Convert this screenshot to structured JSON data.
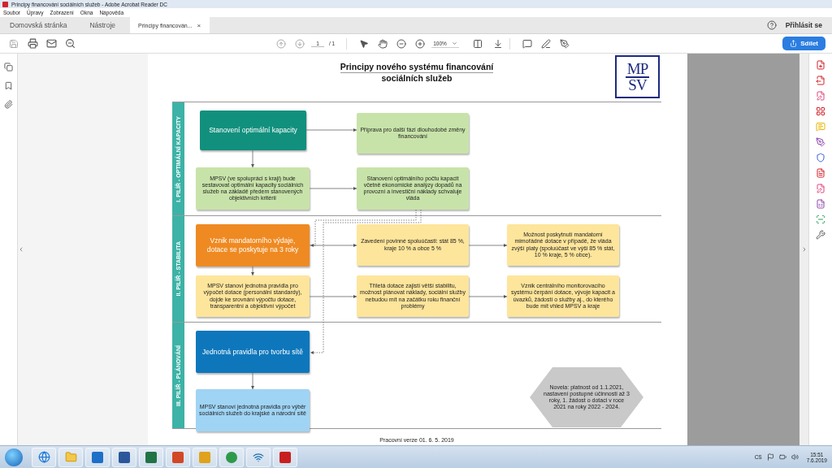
{
  "window": {
    "title": "Principy financování sociálních služeb - Adobe Acrobat Reader DC"
  },
  "menu": [
    "Soubor",
    "Úpravy",
    "Zobrazení",
    "Okna",
    "Nápověda"
  ],
  "tabs": [
    {
      "label": "Domovská stránka",
      "selected": false
    },
    {
      "label": "Nástroje",
      "selected": false
    },
    {
      "label": "Principy financován...",
      "selected": true,
      "close": "×"
    }
  ],
  "sign_in": "Přihlásit se",
  "toolbar": {
    "page_current": "1",
    "page_total": "/ 1",
    "zoom": "100%",
    "share": "Sdílet"
  },
  "document": {
    "title_lines": [
      "Principy nového systému financování",
      "sociálních služeb"
    ],
    "logo": [
      "MP",
      "SV"
    ],
    "lanes": [
      {
        "label": "I. PILÍŘ - OPTIMÁLNÍ KAPACITY",
        "nodes": [
          {
            "kind": "heading",
            "color": "#12907e",
            "text": "Stanovení optimální kapacity"
          },
          {
            "kind": "detail",
            "color": "#c8e3a9",
            "text": "Příprava pro další fázi dlouhodobé změny financování"
          },
          {
            "kind": "detail",
            "color": "#c8e3a9",
            "text": "MPSV (ve spolupráci s kraji) bude sestavovat optimální kapacity sociálních služeb na základě předem stanovených objektivních kritérií"
          },
          {
            "kind": "detail",
            "color": "#c8e3a9",
            "text": "Stanovení optimálního počtu kapacit včetně ekonomické analýzy dopadů na provozní a investiční náklady schvaluje vláda"
          }
        ]
      },
      {
        "label": "II. PILÍŘ - STABILITA",
        "nodes": [
          {
            "kind": "heading",
            "color": "#ef8a22",
            "text": "Vznik mandatorního výdaje, dotace se poskytuje na 3 roky"
          },
          {
            "kind": "detail",
            "color": "#fde59b",
            "text": "Zavedení povinné spoluúčasti: stát 85 %, kraje 10 % a obce 5 %"
          },
          {
            "kind": "detail",
            "color": "#fde59b",
            "text": "Možnost poskytnutí mandatorní mimořádné dotace v případě, že vláda zvýší platy (spoluúčast ve výši 85 % stát, 10 % kraje, 5 % obce)."
          },
          {
            "kind": "detail",
            "color": "#fde59b",
            "text": "MPSV stanoví jednotná pravidla pro výpočet dotace (personální standardy), dojde ke srovnání výpočtu dotace, transparentní a objektivní výpočet"
          },
          {
            "kind": "detail",
            "color": "#fde59b",
            "text": "Tříletá dotace zajistí větší stabilitu, možnost plánovat náklady, sociální služby nebudou mít na začátku roku finanční problémy"
          },
          {
            "kind": "detail",
            "color": "#fde59b",
            "text": "Vznik centrálního monitorovacího systému čerpání dotace, vývoje kapacit a úvazků, žádostí o služby aj., do kterého bude mít vhled MPSV a kraje"
          }
        ]
      },
      {
        "label": "III. PILÍŘ - PLÁNOVÁNÍ",
        "nodes": [
          {
            "kind": "heading",
            "color": "#0e77bc",
            "text": "Jednotná pravidla pro tvorbu sítě"
          },
          {
            "kind": "detail",
            "color": "#9fd4f4",
            "text": "MPSV stanoví jednotná pravidla pro výběr sociálních služeb do krajské a národní sítě"
          }
        ],
        "note": "Novela: platnost od 1.1.2021, nastavení postupné účinnosti až 3 roky, 1. žádost o dotaci v roce 2021 na roky 2022 - 2024."
      }
    ],
    "footer": "Pracovní verze 01. 6. 5. 2019"
  },
  "taskbar": {
    "language": "CS",
    "time": "15:51",
    "date": "7.6.2019"
  }
}
